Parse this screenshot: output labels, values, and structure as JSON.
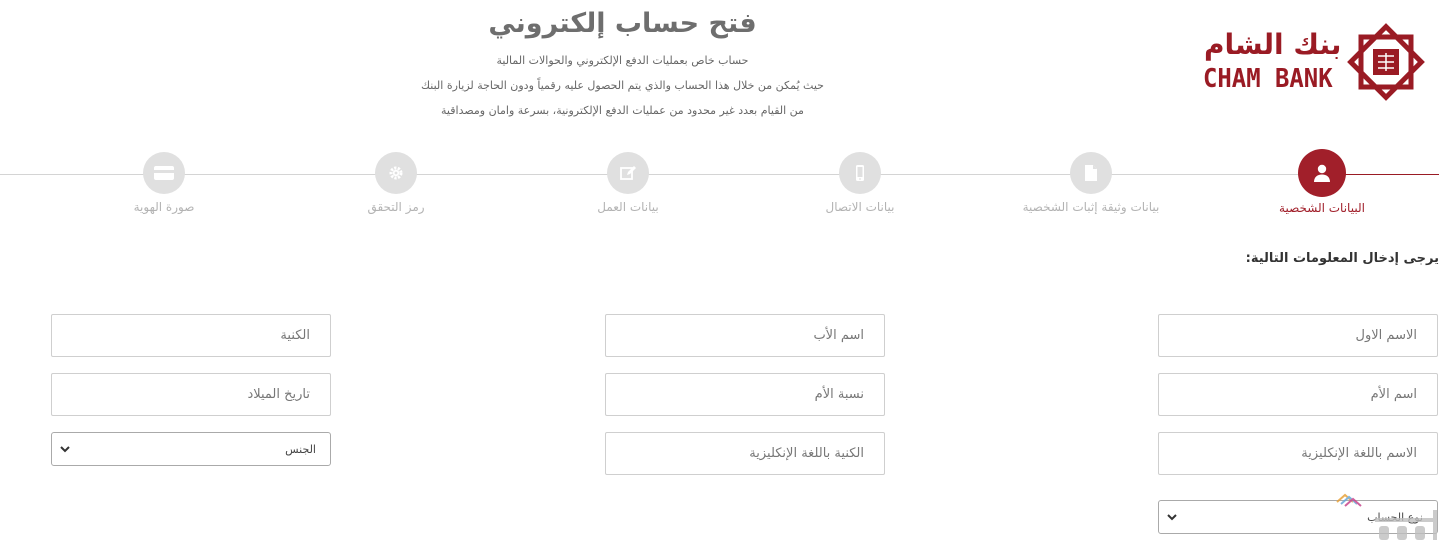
{
  "header": {
    "title": "فتح حساب إلكتروني",
    "lines": [
      "حساب خاص بعمليات الدفع الإلكتروني والحوالات المالية",
      "حيث يُمكن من خلال هذا الحساب والذي يتم الحصول عليه رقمياً ودون الحاجة لزيارة البنك",
      "من القيام بعدد غير محدود من عمليات الدفع الإلكترونية، بسرعة وامان ومصداقية"
    ]
  },
  "logo": {
    "arabic": "بنك الشام",
    "english": "CHAM BANK"
  },
  "steps": [
    {
      "label": "البيانات الشخصية",
      "icon": "user-icon",
      "active": true
    },
    {
      "label": "بيانات وثيقة إثبات الشخصية",
      "icon": "document-icon",
      "active": false
    },
    {
      "label": "بيانات الاتصال",
      "icon": "mobile-icon",
      "active": false
    },
    {
      "label": "بيانات العمل",
      "icon": "edit-icon",
      "active": false
    },
    {
      "label": "رمز التحقق",
      "icon": "gear-icon",
      "active": false
    },
    {
      "label": "صورة الهوية",
      "icon": "card-icon",
      "active": false
    }
  ],
  "instruction": "يرجى إدخال المعلومات التالية:",
  "form": {
    "first_name": "الاسم الاول",
    "father_name": "اسم الأب",
    "last_name": "الكنية",
    "mother_name": "اسم الأم",
    "mother_surname": "نسبة الأم",
    "birth_date": "تاريخ الميلاد",
    "name_english": "الاسم باللغة الإنكليزية",
    "last_name_english": "الكنية باللغة الإنكليزية",
    "gender": "الجنس",
    "account_type": "نوع الحساب"
  },
  "colors": {
    "brand": "#a11f2a",
    "inactive": "#e0e0e0",
    "muted_text": "#b3b3b3"
  }
}
